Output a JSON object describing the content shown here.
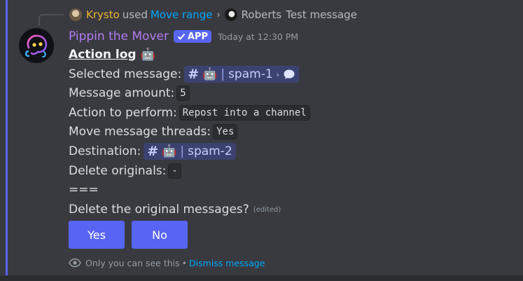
{
  "reply": {
    "author": "Krysto",
    "used_text": "used",
    "command": "Move range",
    "chevron": "›",
    "target_author": "Roberts",
    "snippet": "Test message"
  },
  "message": {
    "bot_name": "Pippin the Mover",
    "badge": "APP",
    "timestamp": "Today at 12:30 PM",
    "title": "Action log",
    "title_emoji": "🤖",
    "fields": {
      "selected_label": "Selected message:",
      "selected_channel": "spam-1",
      "amount_label": "Message amount:",
      "amount_value": "5",
      "action_label": "Action to perform:",
      "action_value": "Repost into a channel",
      "threads_label": "Move message threads:",
      "threads_value": "Yes",
      "destination_label": "Destination:",
      "destination_channel": "spam-2",
      "delete_label": "Delete originals:",
      "delete_value": "-"
    },
    "separator": "===",
    "question": "Delete the original messages?",
    "edited": "(edited)"
  },
  "mention_glyphs": {
    "hash": "#",
    "robot": "🤖",
    "divider": "|",
    "arrow": "›"
  },
  "buttons": {
    "yes": "Yes",
    "no": "No"
  },
  "footer": {
    "notice": "Only you can see this",
    "dot": "•",
    "dismiss": "Dismiss message"
  },
  "colors": {
    "accent": "#5865f2",
    "bot_name": "#b37cf2",
    "reply_author": "#f0b232",
    "link": "#00a8fc",
    "background": "#393a40"
  },
  "icons": [
    "reply-avatar-krysto",
    "reply-avatar-roberts",
    "bot-avatar",
    "checkmark-icon",
    "thread-bubble-icon",
    "eye-icon"
  ]
}
